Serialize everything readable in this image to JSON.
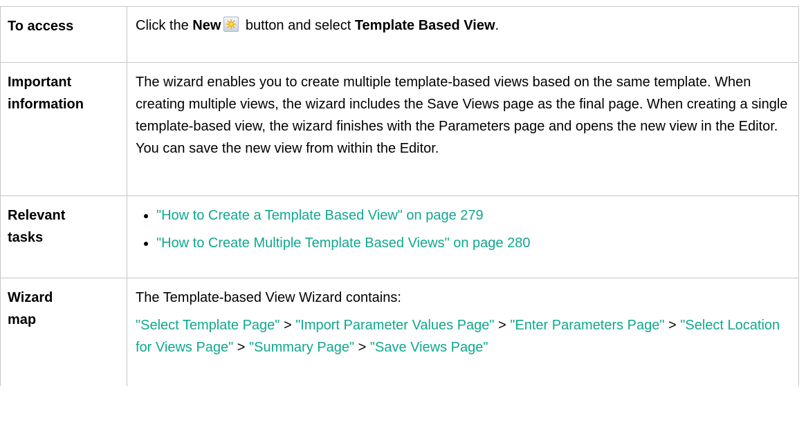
{
  "rows": {
    "access": {
      "label": "To access",
      "text_prefix": "Click the ",
      "button_name": "New",
      "text_middle": " button and select ",
      "option": "Template Based View",
      "text_suffix": ".",
      "icon": "new-star-icon"
    },
    "important": {
      "label_line1": "Important",
      "label_line2": "information",
      "text": "The wizard enables you to create multiple template-based views based on the same template. When creating multiple views, the wizard includes the Save Views page as the final page. When creating a single template-based view, the wizard finishes with the Parameters page and opens the new view in the Editor. You can save the new view from within the Editor."
    },
    "tasks": {
      "label_line1": "Relevant",
      "label_line2": "tasks",
      "items": [
        "\"How to Create a Template Based View\" on page 279",
        "\"How to Create Multiple Template Based Views\" on page 280"
      ]
    },
    "wizard_map": {
      "label_line1": "Wizard",
      "label_line2": "map",
      "intro": "The Template-based View Wizard contains:",
      "separator": " > ",
      "pages": [
        "\"Select Template Page\"",
        "\"Import Parameter Values Page\"",
        "\"Enter Parameters Page\"",
        "\"Select Location for Views Page\"",
        "\"Summary Page\"",
        "\"Save Views Page\""
      ]
    }
  },
  "colors": {
    "link": "#0fa88e",
    "border": "#c6c6c6"
  }
}
